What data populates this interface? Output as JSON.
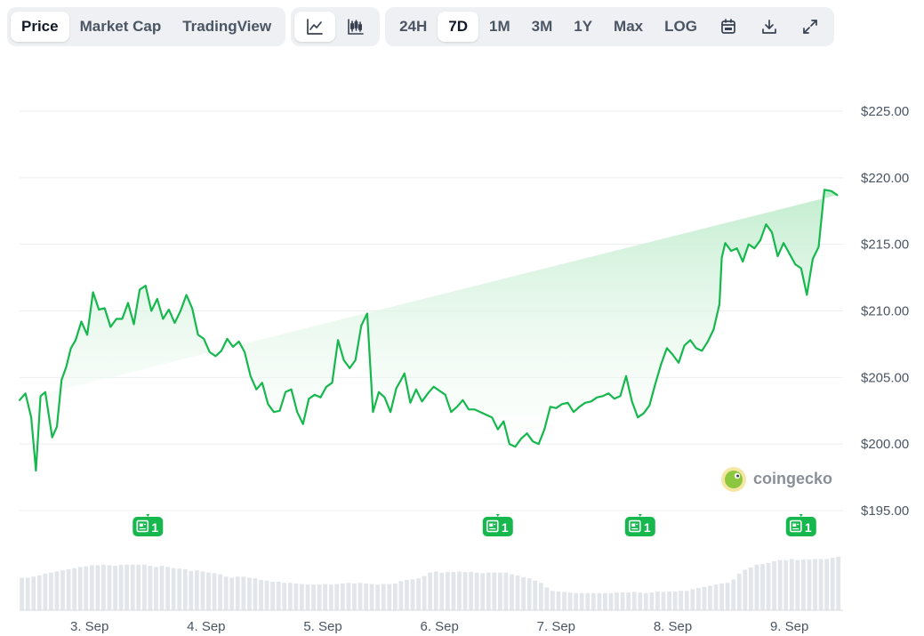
{
  "toolbar": {
    "metric_tabs": [
      {
        "label": "Price",
        "active": true
      },
      {
        "label": "Market Cap",
        "active": false
      },
      {
        "label": "TradingView",
        "active": false
      }
    ],
    "chart_type_icons": [
      "line-chart-icon",
      "candlestick-icon"
    ],
    "range_tabs": [
      {
        "label": "24H",
        "active": false
      },
      {
        "label": "7D",
        "active": true
      },
      {
        "label": "1M",
        "active": false
      },
      {
        "label": "3M",
        "active": false
      },
      {
        "label": "1Y",
        "active": false
      },
      {
        "label": "Max",
        "active": false
      },
      {
        "label": "LOG",
        "active": false
      }
    ],
    "action_icons": [
      "calendar-icon",
      "download-icon",
      "fullscreen-icon"
    ]
  },
  "watermark": {
    "text": "coingecko"
  },
  "colors": {
    "line": "#16b84e",
    "area_top": "#bfeccc",
    "volume": "#e2e5ea",
    "news_badge": "#16b84e"
  },
  "chart_data": {
    "type": "area",
    "y_ticks": [
      "$225.00",
      "$220.00",
      "$215.00",
      "$210.00",
      "$205.00",
      "$200.00",
      "$195.00"
    ],
    "ylim": [
      195,
      225
    ],
    "x_ticks": [
      "3. Sep",
      "4. Sep",
      "5. Sep",
      "6. Sep",
      "7. Sep",
      "8. Sep",
      "9. Sep"
    ],
    "x_tick_positions": [
      3,
      4,
      5,
      6,
      7,
      8,
      9
    ],
    "xlim": [
      2.4,
      9.46
    ],
    "grid": true,
    "price_series": {
      "x": [
        2.4,
        2.45,
        2.5,
        2.54,
        2.58,
        2.62,
        2.68,
        2.72,
        2.76,
        2.8,
        2.84,
        2.88,
        2.93,
        2.98,
        3.03,
        3.08,
        3.13,
        3.18,
        3.23,
        3.28,
        3.33,
        3.38,
        3.43,
        3.48,
        3.53,
        3.58,
        3.63,
        3.68,
        3.73,
        3.78,
        3.83,
        3.88,
        3.93,
        3.98,
        4.03,
        4.08,
        4.13,
        4.18,
        4.23,
        4.28,
        4.33,
        4.38,
        4.43,
        4.48,
        4.53,
        4.58,
        4.63,
        4.68,
        4.73,
        4.78,
        4.83,
        4.88,
        4.93,
        4.98,
        5.03,
        5.08,
        5.13,
        5.18,
        5.23,
        5.28,
        5.33,
        5.38,
        5.43,
        5.48,
        5.53,
        5.58,
        5.63,
        5.67,
        5.7,
        5.75,
        5.8,
        5.85,
        5.9,
        5.95,
        6.0,
        6.05,
        6.1,
        6.15,
        6.2,
        6.25,
        6.3,
        6.35,
        6.4,
        6.45,
        6.5,
        6.55,
        6.6,
        6.65,
        6.7,
        6.75,
        6.8,
        6.85,
        6.9,
        6.95,
        7.0,
        7.05,
        7.1,
        7.15,
        7.2,
        7.25,
        7.3,
        7.35,
        7.4,
        7.45,
        7.5,
        7.55,
        7.6,
        7.65,
        7.7,
        7.75,
        7.8,
        7.85,
        7.9,
        7.95,
        8.0,
        8.05,
        8.1,
        8.15,
        8.2,
        8.25,
        8.3,
        8.35,
        8.4,
        8.42,
        8.45,
        8.5,
        8.55,
        8.6,
        8.65,
        8.7,
        8.75,
        8.8,
        8.85,
        8.9,
        8.95,
        9.0,
        9.05,
        9.1,
        9.15,
        9.2,
        9.25,
        9.3,
        9.36,
        9.41,
        9.46
      ],
      "y": [
        203.3,
        203.8,
        202.0,
        198.0,
        203.6,
        203.9,
        200.5,
        201.3,
        204.8,
        205.8,
        207.2,
        207.8,
        209.2,
        208.2,
        211.4,
        210.1,
        210.2,
        208.8,
        209.4,
        209.4,
        210.6,
        209.0,
        211.6,
        211.9,
        210.0,
        210.9,
        209.4,
        210.1,
        209.1,
        210.0,
        211.2,
        210.2,
        208.2,
        207.9,
        206.9,
        206.6,
        207.0,
        207.9,
        207.3,
        207.7,
        206.9,
        205.1,
        204.1,
        204.6,
        203.0,
        202.4,
        202.5,
        203.9,
        204.1,
        202.4,
        201.5,
        203.4,
        203.7,
        203.5,
        204.3,
        204.6,
        207.8,
        206.3,
        205.7,
        206.3,
        208.9,
        209.8,
        202.4,
        203.9,
        203.5,
        202.4,
        204.2,
        204.8,
        205.3,
        203.1,
        204.1,
        203.2,
        203.8,
        204.3,
        204.0,
        203.7,
        202.4,
        202.8,
        203.3,
        202.6,
        202.6,
        202.4,
        202.2,
        202.0,
        201.1,
        201.7,
        200.0,
        199.8,
        200.4,
        200.8,
        200.2,
        200.0,
        201.1,
        202.8,
        202.7,
        203.0,
        203.1,
        202.4,
        202.8,
        203.1,
        203.2,
        203.5,
        203.6,
        203.8,
        203.4,
        203.6,
        205.1,
        203.2,
        202.0,
        202.3,
        202.9,
        204.5,
        206.0,
        207.2,
        206.7,
        206.1,
        207.4,
        207.8,
        207.2,
        207.0,
        207.7,
        208.6,
        210.5,
        214.0,
        215.1,
        214.5,
        214.7,
        213.7,
        215.0,
        214.7,
        215.3,
        216.5,
        215.9,
        214.1,
        215.1,
        214.3,
        213.5,
        213.2,
        211.2,
        213.9,
        214.8,
        219.1,
        219.0,
        218.7
      ]
    },
    "volume_series": {
      "x": [
        2.42,
        2.47,
        2.52,
        2.57,
        2.62,
        2.67,
        2.72,
        2.77,
        2.82,
        2.87,
        2.92,
        2.97,
        3.02,
        3.07,
        3.12,
        3.17,
        3.22,
        3.27,
        3.32,
        3.37,
        3.42,
        3.47,
        3.52,
        3.57,
        3.62,
        3.67,
        3.72,
        3.77,
        3.82,
        3.87,
        3.92,
        3.97,
        4.02,
        4.07,
        4.12,
        4.17,
        4.22,
        4.27,
        4.32,
        4.37,
        4.42,
        4.47,
        4.52,
        4.57,
        4.62,
        4.67,
        4.72,
        4.77,
        4.82,
        4.87,
        4.92,
        4.97,
        5.02,
        5.07,
        5.12,
        5.17,
        5.22,
        5.27,
        5.32,
        5.37,
        5.42,
        5.47,
        5.52,
        5.57,
        5.62,
        5.67,
        5.72,
        5.77,
        5.82,
        5.87,
        5.92,
        5.97,
        6.02,
        6.07,
        6.12,
        6.17,
        6.22,
        6.27,
        6.32,
        6.37,
        6.42,
        6.47,
        6.52,
        6.57,
        6.62,
        6.67,
        6.72,
        6.77,
        6.82,
        6.87,
        6.92,
        6.97,
        7.02,
        7.07,
        7.12,
        7.17,
        7.22,
        7.27,
        7.32,
        7.37,
        7.42,
        7.47,
        7.52,
        7.57,
        7.62,
        7.67,
        7.72,
        7.77,
        7.82,
        7.87,
        7.92,
        7.97,
        8.02,
        8.07,
        8.12,
        8.17,
        8.22,
        8.27,
        8.32,
        8.37,
        8.42,
        8.47,
        8.52,
        8.57,
        8.62,
        8.67,
        8.72,
        8.77,
        8.82,
        8.87,
        8.92,
        8.97,
        9.02,
        9.07,
        9.12,
        9.17,
        9.22,
        9.27,
        9.32,
        9.37,
        9.42
      ],
      "values": [
        0.57,
        0.57,
        0.59,
        0.61,
        0.64,
        0.66,
        0.68,
        0.7,
        0.72,
        0.74,
        0.76,
        0.77,
        0.79,
        0.79,
        0.8,
        0.79,
        0.78,
        0.8,
        0.8,
        0.8,
        0.8,
        0.8,
        0.78,
        0.76,
        0.78,
        0.76,
        0.74,
        0.73,
        0.72,
        0.69,
        0.7,
        0.68,
        0.66,
        0.65,
        0.63,
        0.59,
        0.57,
        0.59,
        0.59,
        0.57,
        0.56,
        0.53,
        0.52,
        0.5,
        0.5,
        0.48,
        0.48,
        0.47,
        0.46,
        0.45,
        0.45,
        0.45,
        0.46,
        0.45,
        0.46,
        0.47,
        0.48,
        0.47,
        0.48,
        0.47,
        0.46,
        0.45,
        0.46,
        0.46,
        0.47,
        0.51,
        0.53,
        0.54,
        0.56,
        0.6,
        0.66,
        0.68,
        0.66,
        0.67,
        0.67,
        0.68,
        0.67,
        0.67,
        0.66,
        0.65,
        0.66,
        0.66,
        0.66,
        0.66,
        0.63,
        0.61,
        0.58,
        0.56,
        0.52,
        0.48,
        0.4,
        0.34,
        0.33,
        0.32,
        0.31,
        0.3,
        0.3,
        0.3,
        0.3,
        0.3,
        0.3,
        0.3,
        0.31,
        0.31,
        0.31,
        0.32,
        0.31,
        0.3,
        0.31,
        0.33,
        0.32,
        0.33,
        0.33,
        0.34,
        0.34,
        0.37,
        0.39,
        0.41,
        0.43,
        0.45,
        0.47,
        0.48,
        0.54,
        0.64,
        0.71,
        0.75,
        0.8,
        0.81,
        0.83,
        0.86,
        0.88,
        0.88,
        0.9,
        0.88,
        0.89,
        0.89,
        0.9,
        0.9,
        0.9,
        0.92,
        0.94
      ]
    },
    "news_markers": [
      {
        "x": 3.5,
        "label": "1"
      },
      {
        "x": 6.5,
        "label": "1"
      },
      {
        "x": 7.72,
        "label": "1"
      },
      {
        "x": 9.1,
        "label": "1"
      }
    ]
  }
}
